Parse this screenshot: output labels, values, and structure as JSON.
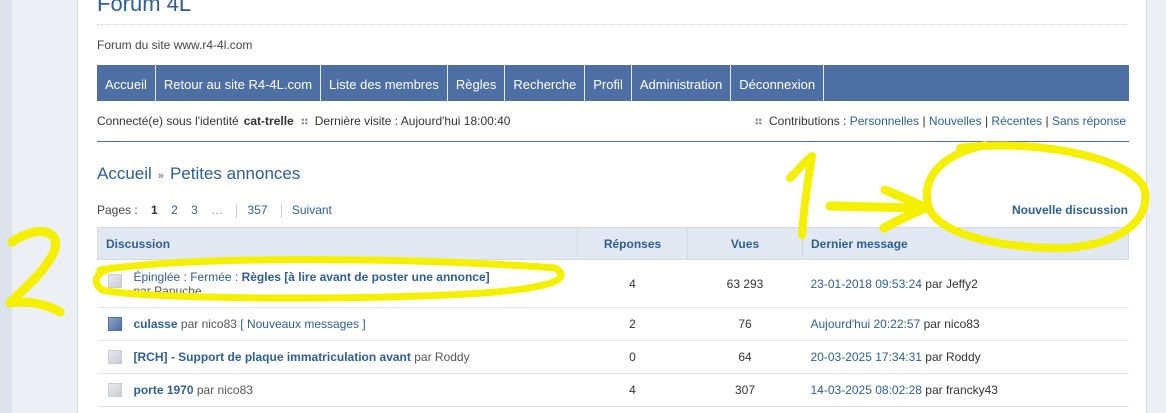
{
  "forum": {
    "title": "Forum 4L",
    "description": "Forum du site www.r4-4l.com"
  },
  "nav": [
    "Accueil",
    "Retour au site R4-4L.com",
    "Liste des membres",
    "Règles",
    "Recherche",
    "Profil",
    "Administration",
    "Déconnexion"
  ],
  "status": {
    "connected_label": "Connecté(e) sous l'identité",
    "username": "cat-trelle",
    "last_visit": "Dernière visite : Aujourd'hui 18:00:40",
    "contributions_label": "Contributions :",
    "links": [
      "Personnelles",
      "Nouvelles",
      "Récentes",
      "Sans réponse"
    ],
    "link_sep": "|"
  },
  "breadcrumb": {
    "home": "Accueil",
    "arrow": "»",
    "current": "Petites annonces"
  },
  "pager": {
    "label": "Pages :",
    "pages": [
      "1",
      "2",
      "3",
      "…",
      "357"
    ],
    "next": "Suivant"
  },
  "new_discussion": "Nouvelle discussion",
  "table": {
    "headers": [
      "Discussion",
      "Réponses",
      "Vues",
      "Dernier message"
    ],
    "rows": [
      {
        "prefix": "Épinglée : Fermée :",
        "title": "Règles [à lire avant de poster une annonce]",
        "by": "par Papuche",
        "extra": "",
        "replies": "4",
        "views": "63 293",
        "last_date": "23-01-2018 09:53:24",
        "last_by": "par Jeffy2"
      },
      {
        "prefix": "",
        "title": "culasse",
        "by": "par nico83",
        "extra": "[ Nouveaux messages ]",
        "replies": "2",
        "views": "76",
        "last_date": "Aujourd'hui 20:22:57",
        "last_by": "par nico83"
      },
      {
        "prefix": "[RCH] -",
        "title": "Support de plaque immatriculation avant",
        "by": "par Roddy",
        "extra": "",
        "replies": "0",
        "views": "64",
        "last_date": "20-03-2025 17:34:31",
        "last_by": "par Roddy"
      },
      {
        "prefix": "",
        "title": "porte 1970",
        "by": "par nico83",
        "extra": "",
        "replies": "4",
        "views": "307",
        "last_date": "14-03-2025 08:02:28",
        "last_by": "par francky43"
      }
    ]
  },
  "annotation_color": "#f5f000"
}
